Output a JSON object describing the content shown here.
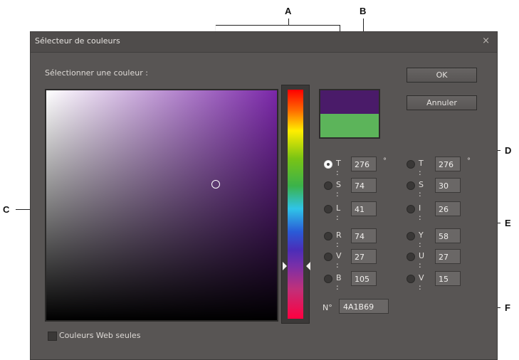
{
  "callouts": {
    "a": "A",
    "b": "B",
    "c": "C",
    "d": "D",
    "e": "E",
    "f": "F"
  },
  "dialog": {
    "title": "Sélecteur de couleurs",
    "close": "×",
    "select_label": "Sélectionner une couleur :",
    "ok_label": "OK",
    "cancel_label": "Annuler",
    "web_colors_label": "Couleurs Web seules",
    "degree_symbol": "°"
  },
  "colors": {
    "new_color": "#4a1b69",
    "old_color": "#5cb45a"
  },
  "fields_left": [
    {
      "label": "T :",
      "value": "276",
      "checked": true
    },
    {
      "label": "S :",
      "value": "74",
      "checked": false
    },
    {
      "label": "L :",
      "value": "41",
      "checked": false
    },
    {
      "label": "R :",
      "value": "74",
      "checked": false
    },
    {
      "label": "V :",
      "value": "27",
      "checked": false
    },
    {
      "label": "B :",
      "value": "105",
      "checked": false
    }
  ],
  "fields_right": [
    {
      "label": "T :",
      "value": "276",
      "checked": false
    },
    {
      "label": "S :",
      "value": "30",
      "checked": false
    },
    {
      "label": "I :",
      "value": "26",
      "checked": false
    },
    {
      "label": "Y :",
      "value": "58",
      "checked": false
    },
    {
      "label": "U :",
      "value": "27",
      "checked": false
    },
    {
      "label": "V :",
      "value": "15",
      "checked": false
    }
  ],
  "hex": {
    "label": "N°",
    "value": "4A1B69"
  }
}
